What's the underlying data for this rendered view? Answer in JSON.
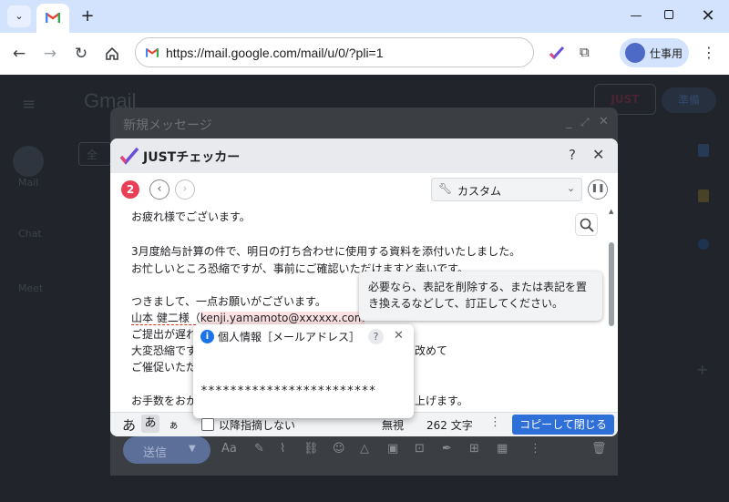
{
  "browser": {
    "url": "https://mail.google.com/mail/u/0/?pli=1",
    "profile_label": "仕事用",
    "tab_favicon": "gmail-icon"
  },
  "gmail": {
    "app_name": "Gmail",
    "sidebar": [
      {
        "label": "Mail"
      },
      {
        "label": "Chat"
      },
      {
        "label": "Meet"
      }
    ],
    "select_all_label": "全",
    "badge_label": "JUST",
    "right_button_label": "準備",
    "compose_title": "新規メッセージ",
    "send_label": "送信"
  },
  "checker": {
    "title": "JUSTチェッカー",
    "count": "2",
    "preset": "カスタム",
    "help": "?",
    "lines": [
      "お疲れ様でございます。",
      "",
      "3月度給与計算の件で、明日の打ち合わせに使用する資料を添付いたしました。",
      "お忙しいところ恐縮ですが、事前にご確認いただけますと幸いです。",
      "",
      "つきまして、一点お願いがございます。"
    ],
    "name_text": "山本 健二様（",
    "email_text": "kenji.yamamoto@xxxxxx.com",
    "partial_lines": [
      {
        "left": "ご提出が遅れ",
        "right": ""
      },
      {
        "left": "大変恐縮です",
        "right": "改めて"
      },
      {
        "left": "ご催促いただ",
        "right": ""
      }
    ],
    "last_line_left": "お手数をおか",
    "last_line_right": "上げます。",
    "footer": {
      "kana1": "あ",
      "kana2": "あ",
      "kana3": "ぁ",
      "char_count": "262 文字",
      "copy_close": "コピーして閉じる"
    }
  },
  "tooltip": {
    "text_line1": "必要なら、表記を削除する、または表記を置",
    "text_line2": "き換えるなどして、訂正してください。"
  },
  "popup": {
    "title": "個人情報［メールアドレス］",
    "masked": "************************",
    "no_more_label": "以降指摘しない",
    "ignore_label": "無視",
    "no_more_checked": false
  }
}
